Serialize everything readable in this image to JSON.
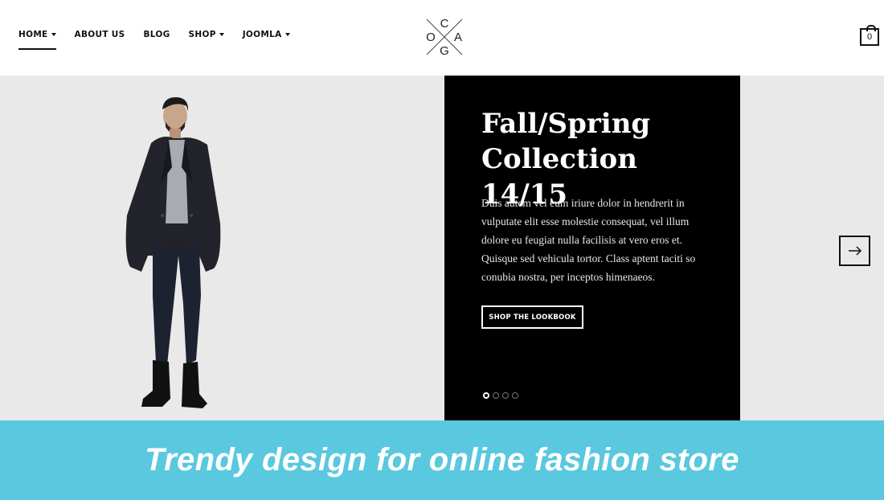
{
  "nav": {
    "items": [
      {
        "label": "HOME",
        "dropdown": true,
        "active": true
      },
      {
        "label": "ABOUT US",
        "dropdown": false,
        "active": false
      },
      {
        "label": "BLOG",
        "dropdown": false,
        "active": false
      },
      {
        "label": "SHOP",
        "dropdown": true,
        "active": false
      },
      {
        "label": "JOOMLA",
        "dropdown": true,
        "active": false
      }
    ]
  },
  "logo": {
    "letters": [
      "C",
      "O",
      "A",
      "G"
    ]
  },
  "cart": {
    "count": "0",
    "icon": "shopping-bag-icon"
  },
  "hero": {
    "title": "Fall/Spring Collection 14/15",
    "body": "Duis autem vel eum iriure dolor in hendrerit in vulputate elit esse molestie consequat, vel illum dolore eu feugiat nulla facilisis at vero eros et. Quisque sed vehicula tortor. Class aptent taciti so conubia nostra, per inceptos himenaeos.",
    "button_label": "SHOP THE LOOKBOOK",
    "slides_total": 4,
    "active_slide": 1,
    "next_icon": "arrow-right-icon"
  },
  "banner": {
    "text": "Trendy design for online fashion store"
  },
  "colors": {
    "banner": "#5ac8de",
    "hero_bg": "#e9e9e9",
    "panel": "#000000"
  }
}
